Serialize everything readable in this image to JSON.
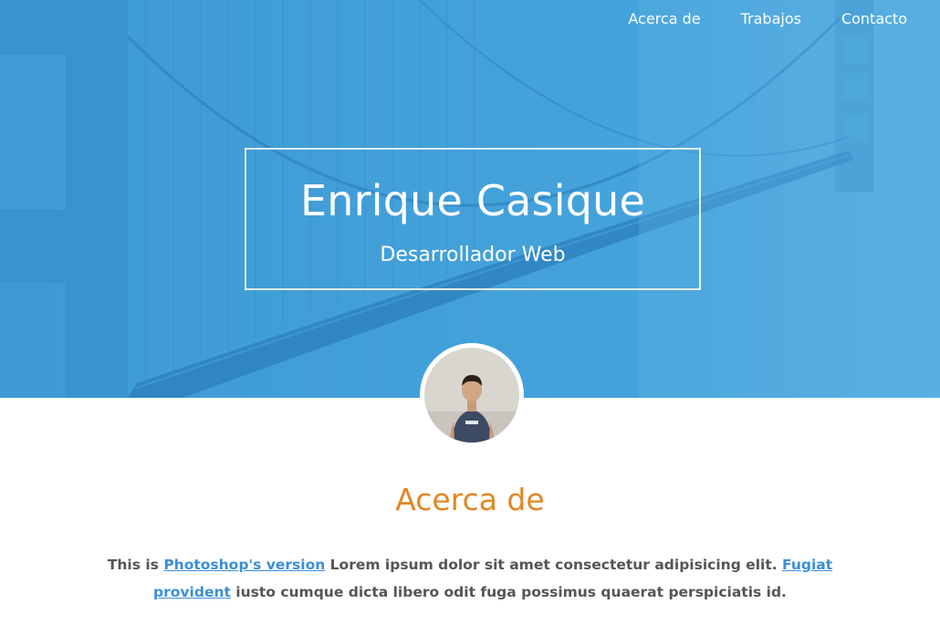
{
  "nav": {
    "items": [
      {
        "label": "Acerca de"
      },
      {
        "label": "Trabajos"
      },
      {
        "label": "Contacto"
      }
    ]
  },
  "hero": {
    "name": "Enrique Casique",
    "role": "Desarrollador Web",
    "accent_color": "#3f9fd8"
  },
  "about": {
    "title": "Acerca de",
    "title_color": "#e08726",
    "text_prefix": "This is ",
    "link1": "Photoshop's version",
    "text_middle": " Lorem ipsum dolor sit amet consectetur adipisicing elit. ",
    "link2": "Fugiat provident",
    "text_suffix": " iusto cumque dicta libero odit fuga possimus quaerat perspiciatis id.",
    "link_color": "#3b8fd6"
  }
}
